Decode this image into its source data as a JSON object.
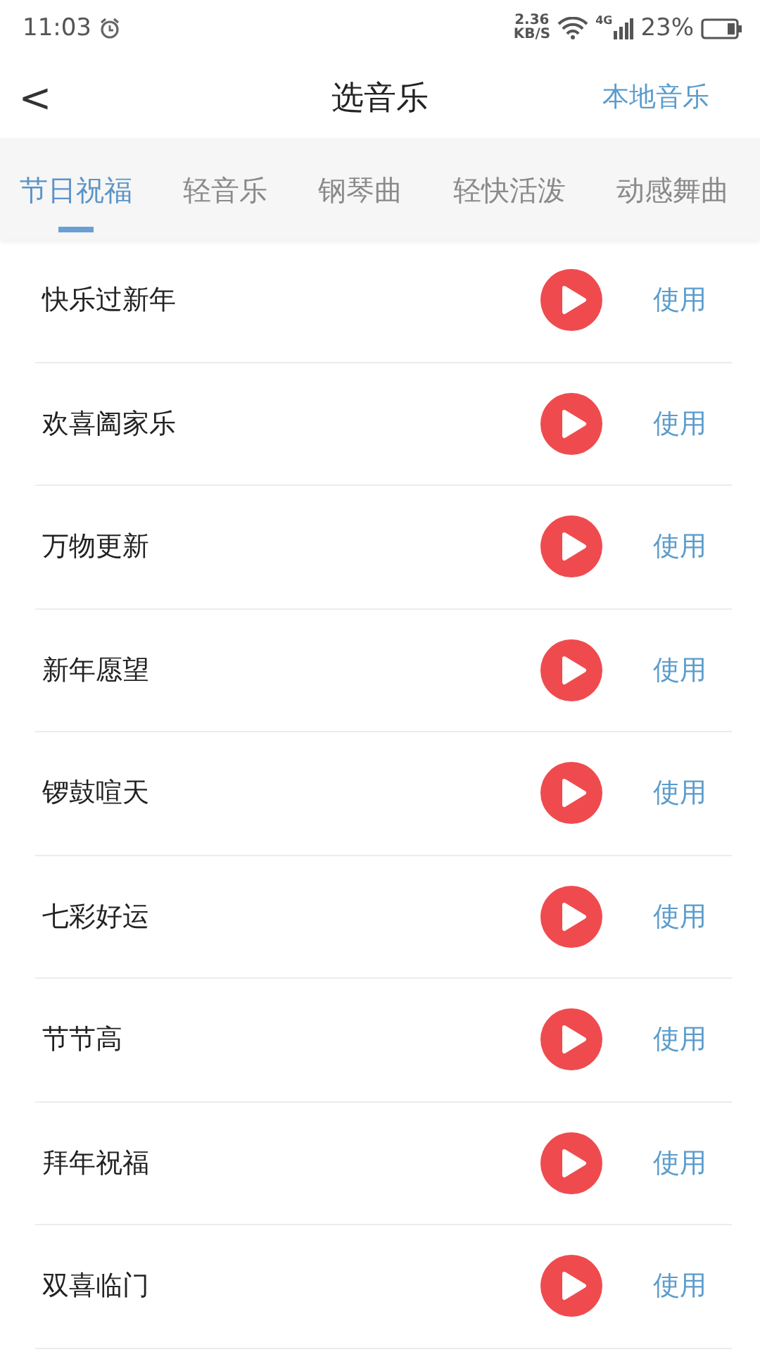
{
  "status_bar": {
    "time": "11:03",
    "speed_value": "2.36",
    "speed_unit": "KB/S",
    "network": "4G",
    "battery": "23%"
  },
  "header": {
    "back": "<",
    "title": "选音乐",
    "action": "本地音乐"
  },
  "tabs": [
    {
      "label": "节日祝福",
      "selected": true
    },
    {
      "label": "轻音乐",
      "selected": false
    },
    {
      "label": "钢琴曲",
      "selected": false
    },
    {
      "label": "轻快活泼",
      "selected": false
    },
    {
      "label": "动感舞曲",
      "selected": false
    }
  ],
  "songs": [
    {
      "title": "快乐过新年",
      "action": "使用"
    },
    {
      "title": "欢喜阖家乐",
      "action": "使用"
    },
    {
      "title": "万物更新",
      "action": "使用"
    },
    {
      "title": "新年愿望",
      "action": "使用"
    },
    {
      "title": "锣鼓喧天",
      "action": "使用"
    },
    {
      "title": "七彩好运",
      "action": "使用"
    },
    {
      "title": "节节高",
      "action": "使用"
    },
    {
      "title": "拜年祝福",
      "action": "使用"
    },
    {
      "title": "双喜临门",
      "action": "使用"
    }
  ]
}
